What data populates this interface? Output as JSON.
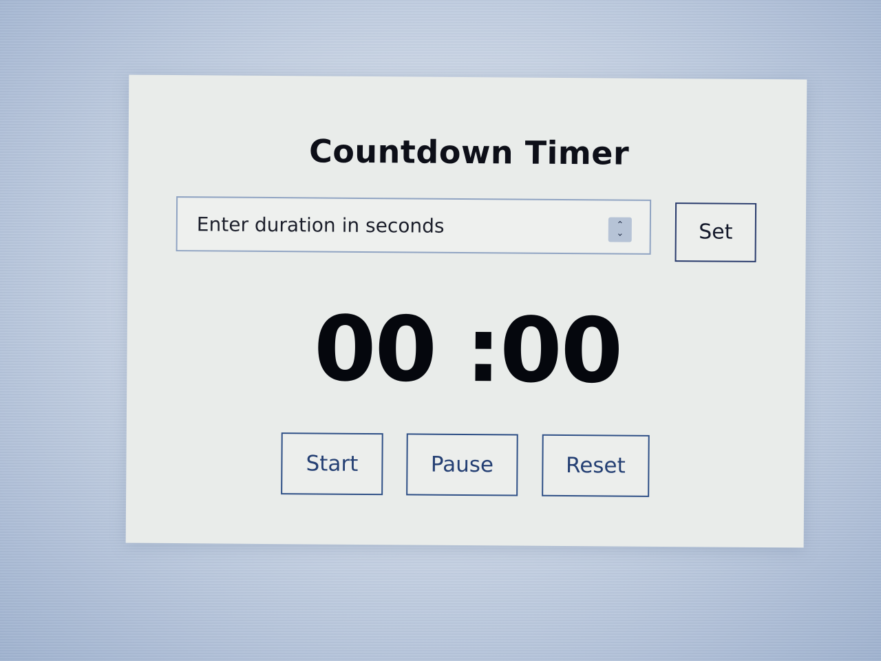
{
  "app": {
    "title": "Countdown Timer"
  },
  "duration_input": {
    "placeholder": "Enter duration in seconds",
    "value": ""
  },
  "buttons": {
    "set_label": "Set",
    "start_label": "Start",
    "pause_label": "Pause",
    "reset_label": "Reset"
  },
  "timer": {
    "display": "00 :00"
  },
  "icons": {
    "spinner": "spinner-up-down-icon"
  },
  "colors": {
    "panel_background": "#e9ecea",
    "button_border": "#2e4f86",
    "button_text": "#243f73",
    "timer_text": "#05070d"
  }
}
